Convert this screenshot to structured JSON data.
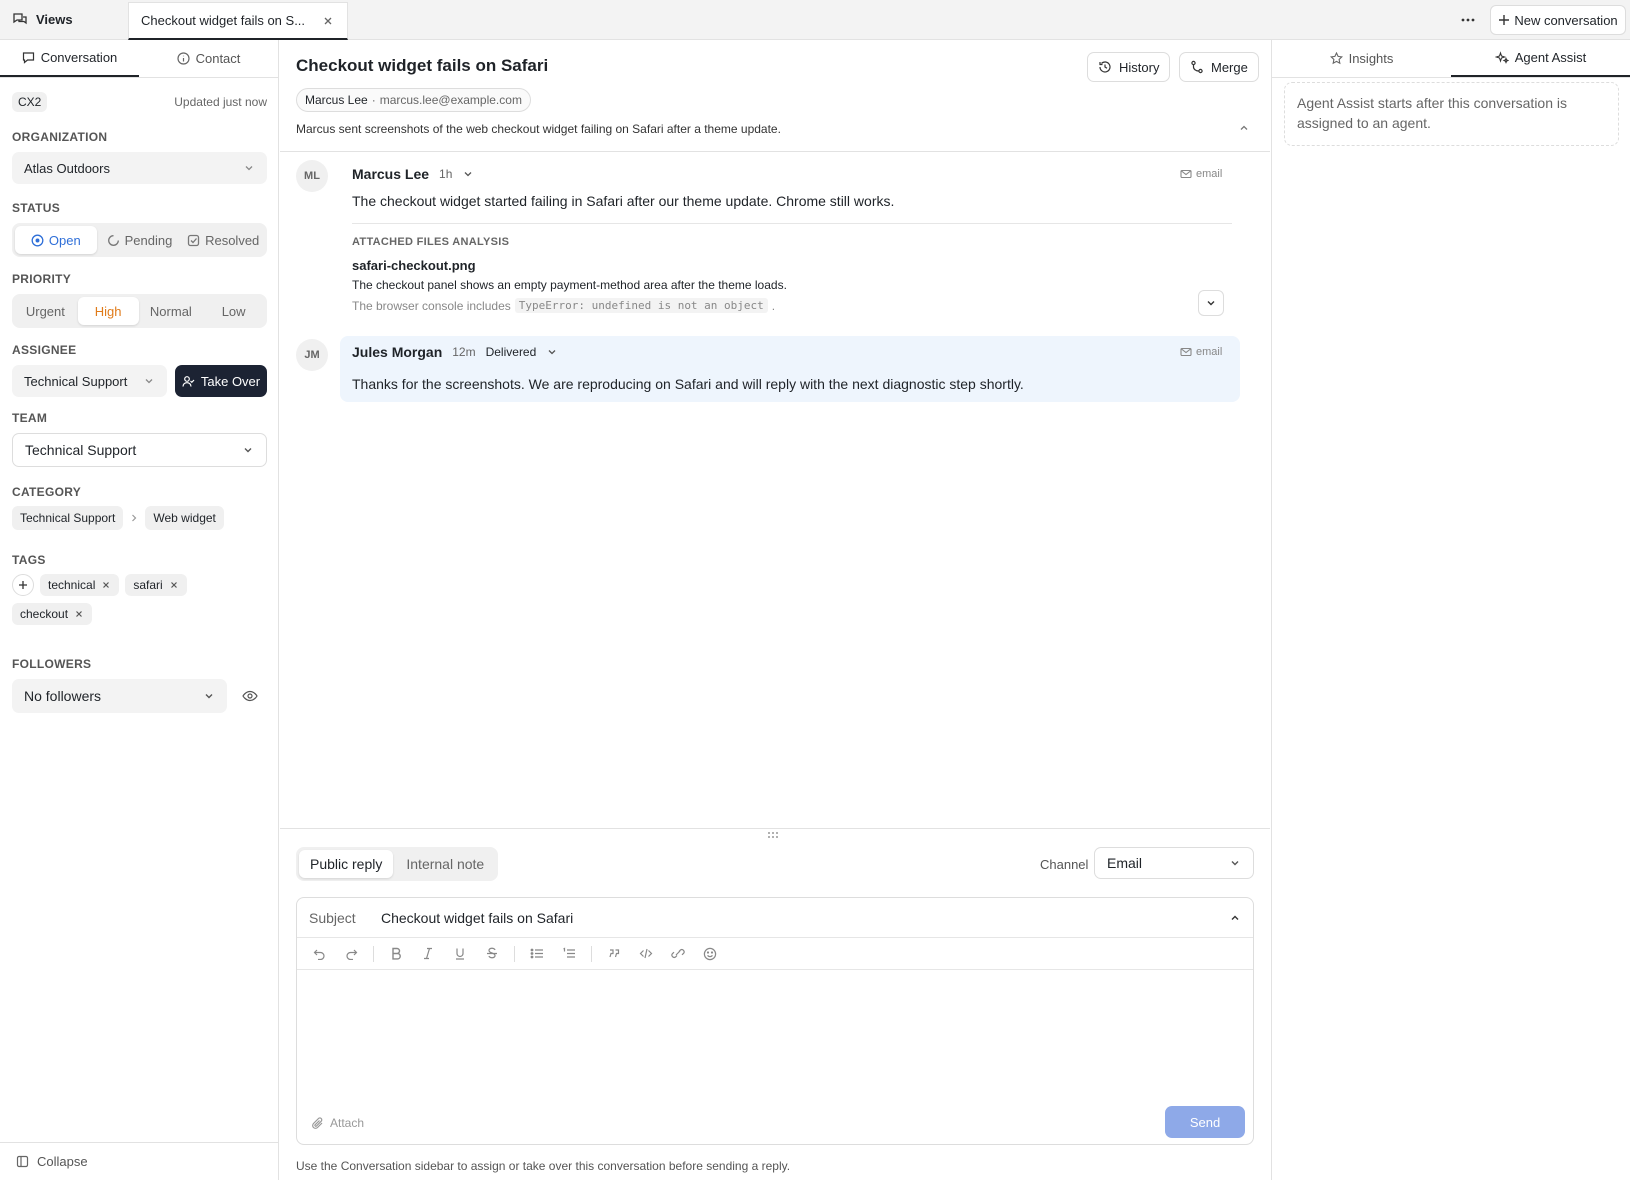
{
  "topbar": {
    "views_label": "Views",
    "active_tab": "Checkout widget fails on S...",
    "new_conversation": "New conversation"
  },
  "sidebar": {
    "tabs": [
      "Conversation",
      "Contact"
    ],
    "id": "CX2",
    "updated": "Updated just now",
    "organization_label": "ORGANIZATION",
    "organization": "Atlas Outdoors",
    "status_label": "STATUS",
    "status_options": [
      "Open",
      "Pending",
      "Resolved"
    ],
    "status_selected": "Open",
    "priority_label": "PRIORITY",
    "priority_options": [
      "Urgent",
      "High",
      "Normal",
      "Low"
    ],
    "priority_selected": "High",
    "assignee_label": "ASSIGNEE",
    "assignee": "Technical Support",
    "take_over": "Take Over",
    "team_label": "TEAM",
    "team": "Technical Support",
    "category_label": "CATEGORY",
    "category": [
      "Technical Support",
      "Web widget"
    ],
    "tags_label": "TAGS",
    "tags": [
      "technical",
      "safari",
      "checkout"
    ],
    "followers_label": "FOLLOWERS",
    "followers": "No followers",
    "collapse": "Collapse"
  },
  "conversation": {
    "title": "Checkout widget fails on Safari",
    "history": "History",
    "merge": "Merge",
    "contact_name": "Marcus Lee",
    "contact_sep": "·",
    "contact_email": "marcus.lee@example.com",
    "summary": "Marcus sent screenshots of the web checkout widget failing on Safari after a theme update.",
    "messages": [
      {
        "initials": "ML",
        "author": "Marcus Lee",
        "time": "1h",
        "channel": "email",
        "text": "The checkout widget started failing in Safari after our theme update. Chrome still works.",
        "attachment_heading": "ATTACHED FILES ANALYSIS",
        "attachment_name": "safari-checkout.png",
        "attachment_line1": "The checkout panel shows an empty payment-method area after the theme loads.",
        "attachment_line2_prefix": "The browser console includes",
        "attachment_code": "TypeError: undefined is not an object",
        "attachment_line2_suffix": "."
      },
      {
        "initials": "JM",
        "author": "Jules Morgan",
        "time": "12m",
        "status": "Delivered",
        "channel": "email",
        "text": "Thanks for the screenshots. We are reproducing on Safari and will reply with the next diagnostic step shortly."
      }
    ]
  },
  "composer": {
    "tabs": [
      "Public reply",
      "Internal note"
    ],
    "channel_label": "Channel",
    "channel": "Email",
    "subject_label": "Subject",
    "subject": "Checkout widget fails on Safari",
    "attach": "Attach",
    "send": "Send",
    "hint": "Use the Conversation sidebar to assign or take over this conversation before sending a reply."
  },
  "right_panel": {
    "tabs": [
      "Insights",
      "Agent Assist"
    ],
    "assist_text": "Agent Assist starts after this conversation is assigned to an agent."
  },
  "colors": {
    "open_blue": "#2f6fd8",
    "high_orange": "#e07b1a",
    "send_disabled": "#8ea9e8",
    "dark_button": "#1c2333",
    "jules_bubble": "#eef5fd"
  }
}
